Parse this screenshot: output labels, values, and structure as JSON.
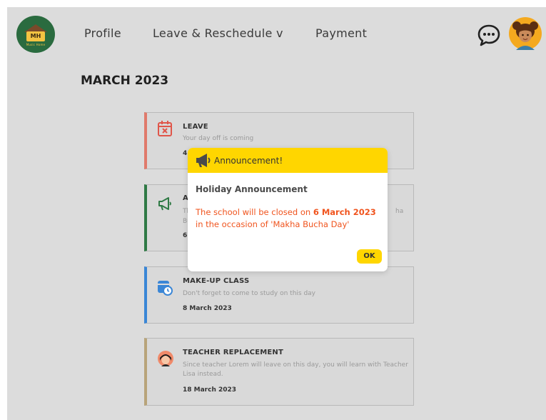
{
  "logo": {
    "initials": "MH",
    "caption": "Music Home"
  },
  "nav": {
    "items": [
      {
        "label": "Profile"
      },
      {
        "label": "Leave & Reschedule v"
      },
      {
        "label": "Payment"
      }
    ]
  },
  "icons": {
    "chat": "chat-bubble-icon",
    "avatar": "user-avatar"
  },
  "page": {
    "title": "MARCH 2023"
  },
  "cards": [
    {
      "type": "leave",
      "title": "LEAVE",
      "description": "Your day off is coming",
      "date": "4",
      "accent": "#e07a6b",
      "icon": "calendar-x-icon"
    },
    {
      "type": "announcement",
      "title": "A",
      "description_left": "Th",
      "description_right": "ha",
      "description_line2": "Bu",
      "date": "6",
      "accent": "#2f7a45",
      "icon": "megaphone-icon"
    },
    {
      "type": "makeup",
      "title": "MAKE-UP CLASS",
      "description": "Don't forget to come to study on this day",
      "date": "8 March 2023",
      "accent": "#3a86d6",
      "icon": "calendar-clock-icon"
    },
    {
      "type": "teacher",
      "title": "TEACHER REPLACEMENT",
      "description": "Since teacher Lorem will leave on this day, you will learn with Teacher Lisa instead.",
      "date": "18 March 2023",
      "accent": "#b8a47a",
      "icon": "teacher-avatar-icon"
    }
  ],
  "modal": {
    "header": "Announcement!",
    "subject": "Holiday Announcement",
    "message_before": "The school will be closed on ",
    "message_bold": "6 March 2023",
    "message_after": " in the occasion of 'Makha Bucha Day'",
    "ok_label": "OK",
    "header_color": "#ffd600",
    "message_color": "#f0541e"
  }
}
